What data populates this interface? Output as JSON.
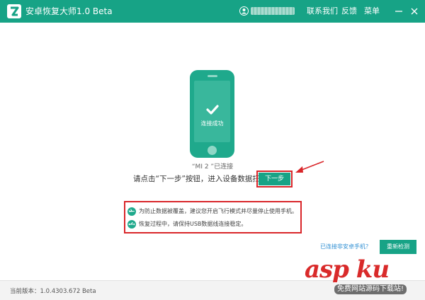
{
  "app": {
    "title": "安卓恢复大师1.0 Beta"
  },
  "header": {
    "username": "",
    "menu": [
      {
        "label": "联系我们"
      },
      {
        "label": "反馈"
      },
      {
        "label": "菜单"
      }
    ]
  },
  "phone": {
    "status_label": "连接成功"
  },
  "device": {
    "connected_text": "“MI 2 ”已连接"
  },
  "instruction": {
    "text": "请点击“下一步”按钮，进入设备数据扫描",
    "next_label": "下一步"
  },
  "tips": [
    {
      "icon": "airplane-icon",
      "text": "为防止数据被覆盖，建议您开启飞行模式并尽量停止使用手机。"
    },
    {
      "icon": "usb-icon",
      "text": "恢复过程中，请保持USB数据线连接稳定。"
    }
  ],
  "bottom": {
    "link_text": "已连接非安卓手机？",
    "button_label": "重新检测"
  },
  "footer": {
    "version_text": "当前版本：1.0.4303.672 Beta"
  },
  "watermark": {
    "main": "asp ku",
    "sub": "免费网站源码下载站!"
  },
  "colors": {
    "brand": "#17a386",
    "highlight": "#d9262a"
  }
}
